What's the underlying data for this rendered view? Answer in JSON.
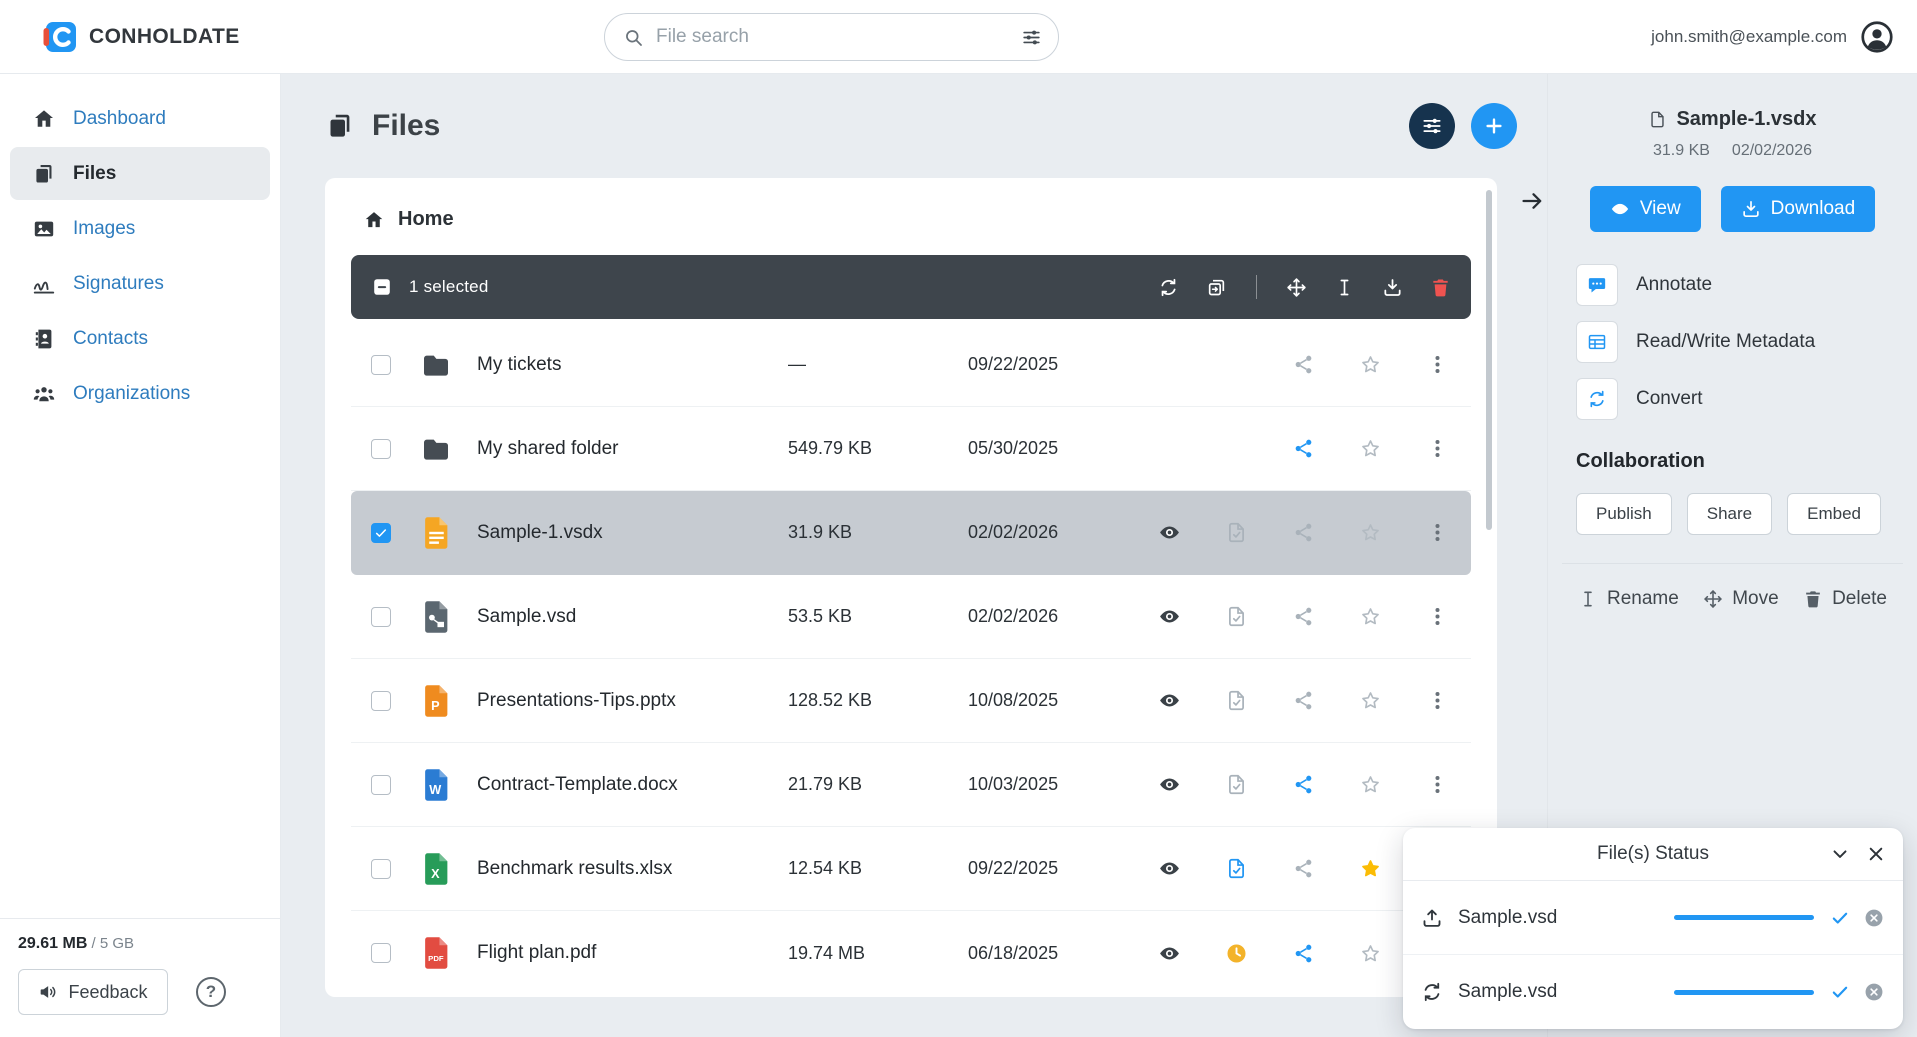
{
  "header": {
    "brand": "CONHOLDATE",
    "search_placeholder": "File search",
    "user_email": "john.smith@example.com"
  },
  "sidebar": {
    "items": [
      {
        "label": "Dashboard"
      },
      {
        "label": "Files"
      },
      {
        "label": "Images"
      },
      {
        "label": "Signatures"
      },
      {
        "label": "Contacts"
      },
      {
        "label": "Organizations"
      }
    ],
    "storage_used": "29.61 MB",
    "storage_total": " / 5 GB",
    "feedback_label": "Feedback",
    "help_glyph": "?"
  },
  "main": {
    "title": "Files",
    "breadcrumb_home": "Home",
    "toolbar": {
      "selected_text": "1 selected"
    },
    "files": [
      {
        "name": "My tickets",
        "type": "folder",
        "size": "—",
        "date": "09/22/2025"
      },
      {
        "name": "My shared folder",
        "type": "folder",
        "size": "549.79 KB",
        "date": "05/30/2025"
      },
      {
        "name": "Sample-1.vsdx",
        "type": "vsdx",
        "size": "31.9 KB",
        "date": "02/02/2026",
        "selected": true
      },
      {
        "name": "Sample.vsd",
        "type": "vsd",
        "size": "53.5 KB",
        "date": "02/02/2026"
      },
      {
        "name": "Presentations-Tips.pptx",
        "type": "pptx",
        "badge": "P",
        "size": "128.52 KB",
        "date": "10/08/2025"
      },
      {
        "name": "Contract-Template.docx",
        "type": "docx",
        "badge": "W",
        "size": "21.79 KB",
        "date": "10/03/2025"
      },
      {
        "name": "Benchmark results.xlsx",
        "type": "xlsx",
        "badge": "X",
        "size": "12.54 KB",
        "date": "09/22/2025",
        "starred": true
      },
      {
        "name": "Flight plan.pdf",
        "type": "pdf",
        "badge": "PDF",
        "size": "19.74 MB",
        "date": "06/18/2025"
      }
    ]
  },
  "details": {
    "file_name": "Sample-1.vsdx",
    "file_size": "31.9 KB",
    "file_date": "02/02/2026",
    "view_label": "View",
    "download_label": "Download",
    "annotate_label": "Annotate",
    "metadata_label": "Read/Write Metadata",
    "convert_label": "Convert",
    "collaboration_title": "Collaboration",
    "publish_label": "Publish",
    "share_label": "Share",
    "embed_label": "Embed",
    "rename_label": "Rename",
    "move_label": "Move",
    "delete_label": "Delete"
  },
  "status_panel": {
    "title": "File(s) Status",
    "items": [
      {
        "name": "Sample.vsd",
        "operation": "upload",
        "progress": 100
      },
      {
        "name": "Sample.vsd",
        "operation": "convert",
        "progress": 100
      }
    ]
  },
  "colors": {
    "accent": "#2196f3",
    "toolbar_dark": "#3e454c",
    "selected_row": "#c6cbd1",
    "star_yellow": "#fbbc05",
    "danger_red": "#ef5350",
    "dark_button": "#16334e"
  }
}
